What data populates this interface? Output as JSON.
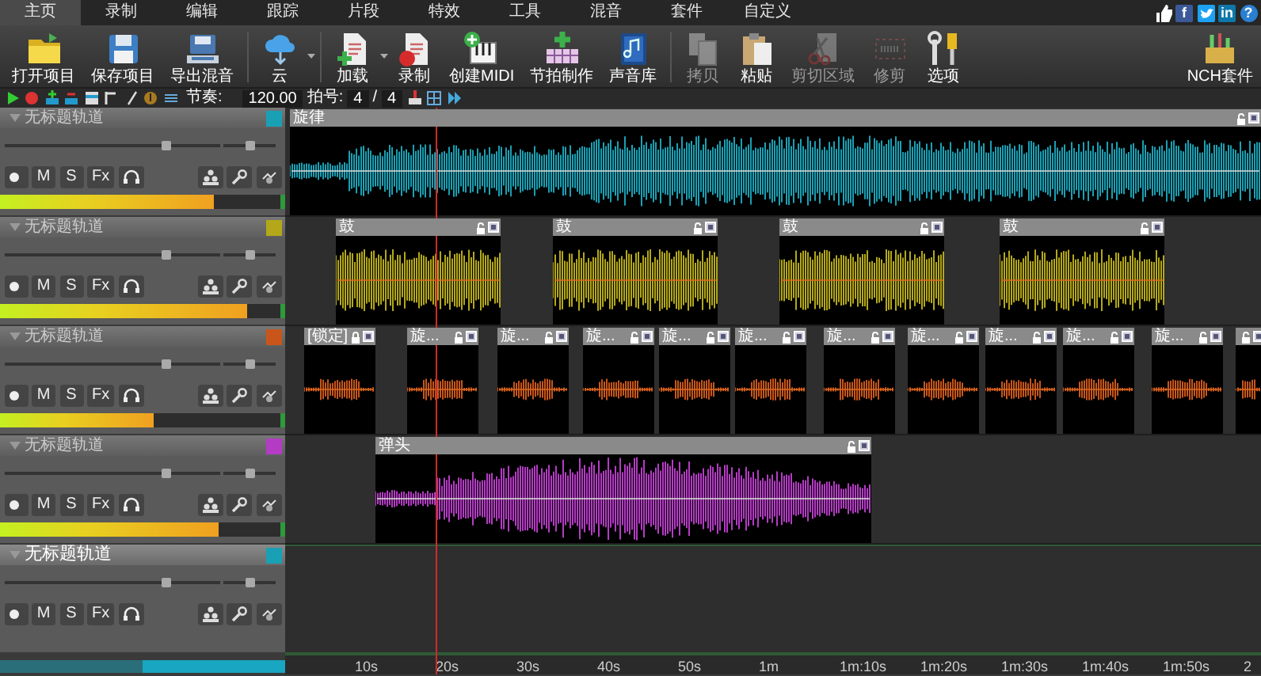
{
  "menu": {
    "tabs": [
      {
        "label": "主页",
        "selected": true
      },
      {
        "label": "录制",
        "selected": false
      },
      {
        "label": "编辑",
        "selected": false
      },
      {
        "label": "跟踪",
        "selected": false
      },
      {
        "label": "片段",
        "selected": false
      },
      {
        "label": "特效",
        "selected": false
      },
      {
        "label": "工具",
        "selected": false
      },
      {
        "label": "混音",
        "selected": false
      },
      {
        "label": "套件",
        "selected": false
      },
      {
        "label": "自定义",
        "selected": false
      }
    ],
    "links": [
      {
        "kind": "like"
      },
      {
        "kind": "facebook",
        "glyph": "f"
      },
      {
        "kind": "twitter"
      },
      {
        "kind": "linkedin",
        "glyph": "in"
      },
      {
        "kind": "help",
        "glyph": "?"
      }
    ]
  },
  "toolbar": {
    "groups": [
      [
        {
          "kind": "folder",
          "label": "打开项目",
          "disabled": false
        },
        {
          "kind": "save",
          "label": "保存项目",
          "disabled": false
        },
        {
          "kind": "export",
          "label": "导出混音",
          "disabled": false
        }
      ],
      [
        {
          "kind": "cloud",
          "label": "云",
          "disabled": false,
          "dropdown": true
        }
      ],
      [
        {
          "kind": "load",
          "label": "加载",
          "disabled": false,
          "dropdown": true
        },
        {
          "kind": "record",
          "label": "录制",
          "disabled": false
        },
        {
          "kind": "midi",
          "label": "创建MIDI",
          "disabled": false
        },
        {
          "kind": "beat",
          "label": "节拍制作",
          "disabled": false
        },
        {
          "kind": "library",
          "label": "声音库",
          "disabled": false
        }
      ],
      [
        {
          "kind": "copy",
          "label": "拷贝",
          "disabled": true
        },
        {
          "kind": "paste",
          "label": "粘贴",
          "disabled": false
        },
        {
          "kind": "cut",
          "label": "剪切区域",
          "disabled": true
        },
        {
          "kind": "trim",
          "label": "修剪",
          "disabled": true
        },
        {
          "kind": "options",
          "label": "选项",
          "disabled": false
        }
      ]
    ],
    "suite": {
      "kind": "suite",
      "label": "NCH套件",
      "disabled": false
    }
  },
  "transport": {
    "tempo_label": "节奏:",
    "tempo": "120.00",
    "signature_label": "拍号:",
    "beats": "4",
    "separator": "/",
    "unit": "4"
  },
  "tracks": [
    {
      "name": "无标题轨道",
      "selected": false,
      "color": "#1aa0b4",
      "volume": {
        "level": 0.75
      },
      "pan": {
        "level": 0.5
      },
      "buttons": [
        "M",
        "S",
        "Fx"
      ],
      "meter": {
        "level": 0.76
      },
      "clips": [
        {
          "label": "旋律",
          "locked": false
        }
      ]
    },
    {
      "name": "无标题轨道",
      "selected": false,
      "color": "#b4a81a",
      "volume": {
        "level": 0.75
      },
      "pan": {
        "level": 0.5
      },
      "buttons": [
        "M",
        "S",
        "Fx"
      ],
      "meter": {
        "level": 0.88
      },
      "clips": [
        {
          "label": "鼓",
          "locked": false
        },
        {
          "label": "鼓",
          "locked": false
        },
        {
          "label": "鼓",
          "locked": false
        },
        {
          "label": "鼓",
          "locked": false
        }
      ]
    },
    {
      "name": "无标题轨道",
      "selected": false,
      "color": "#c8561a",
      "volume": {
        "level": 0.75
      },
      "pan": {
        "level": 0.5
      },
      "buttons": [
        "M",
        "S",
        "Fx"
      ],
      "meter": {
        "level": 0.55
      },
      "clips": [
        {
          "label": "[锁定]",
          "locked": true
        },
        {
          "label": "旋...",
          "locked": false
        },
        {
          "label": "旋...",
          "locked": false
        },
        {
          "label": "旋...",
          "locked": false
        },
        {
          "label": "旋...",
          "locked": false
        },
        {
          "label": "旋...",
          "locked": false
        },
        {
          "label": "旋...",
          "locked": false
        },
        {
          "label": "旋...",
          "locked": false
        },
        {
          "label": "旋...",
          "locked": false
        },
        {
          "label": "旋...",
          "locked": false
        },
        {
          "label": "旋...",
          "locked": false
        },
        {
          "locked": false
        }
      ]
    },
    {
      "name": "无标题轨道",
      "selected": false,
      "color": "#b43cc4",
      "volume": {
        "level": 0.75
      },
      "pan": {
        "level": 0.5
      },
      "buttons": [
        "M",
        "S",
        "Fx"
      ],
      "meter": {
        "level": 0.78
      },
      "clips": [
        {
          "label": "弹头",
          "locked": false
        }
      ]
    },
    {
      "name": "无标题轨道",
      "selected": true,
      "color": "#1aa0b4",
      "volume": {
        "level": 0.75
      },
      "pan": {
        "level": 0.5
      },
      "buttons": [
        "M",
        "S",
        "Fx"
      ]
    }
  ],
  "ruler": {
    "labels": [
      "10s",
      "20s",
      "30s",
      "40s",
      "50s",
      "1m",
      "1m:10s",
      "1m:20s",
      "1m:30s",
      "1m:40s",
      "1m:50s",
      "2"
    ]
  }
}
